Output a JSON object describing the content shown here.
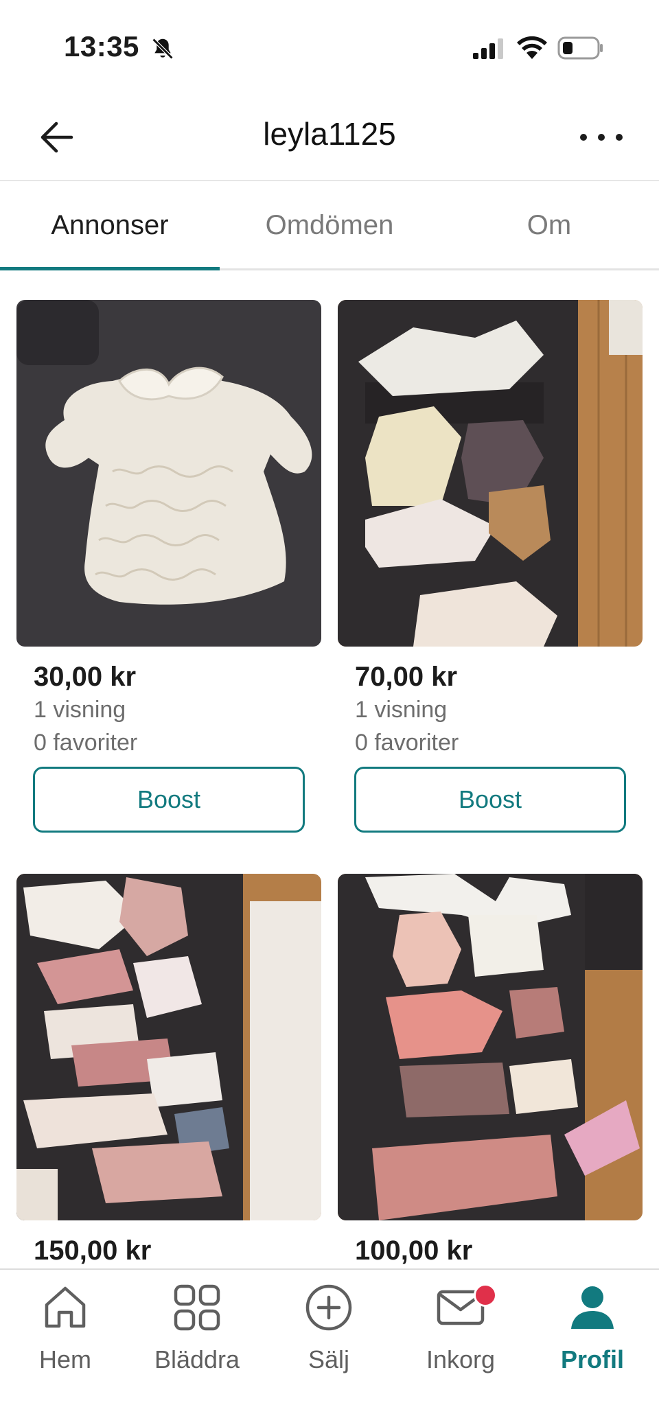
{
  "status_bar": {
    "time": "13:35"
  },
  "header": {
    "title": "leyla1125"
  },
  "tabs": [
    {
      "label": "Annonser",
      "active": true
    },
    {
      "label": "Omdömen",
      "active": false
    },
    {
      "label": "Om",
      "active": false
    }
  ],
  "listings": [
    {
      "price": "30,00 kr",
      "views": "1 visning",
      "favorites": "0 favoriter",
      "button": "Boost",
      "image": "white lace baby dress"
    },
    {
      "price": "70,00 kr",
      "views": "1 visning",
      "favorites": "0 favoriter",
      "button": "Boost",
      "image": "baby clothes on sofa"
    },
    {
      "price": "150,00 kr",
      "image": "pink and white baby clothes"
    },
    {
      "price": "100,00 kr",
      "image": "pink baby outfits"
    }
  ],
  "bottom_nav": [
    {
      "label": "Hem",
      "icon": "home-icon"
    },
    {
      "label": "Bläddra",
      "icon": "grid-icon"
    },
    {
      "label": "Sälj",
      "icon": "plus-circle-icon"
    },
    {
      "label": "Inkorg",
      "icon": "mail-icon",
      "badge": true
    },
    {
      "label": "Profil",
      "icon": "profile-icon",
      "active": true
    }
  ],
  "colors": {
    "accent": "#127a7f",
    "badge": "#e0304a",
    "muted_text": "#6d6d6d"
  }
}
